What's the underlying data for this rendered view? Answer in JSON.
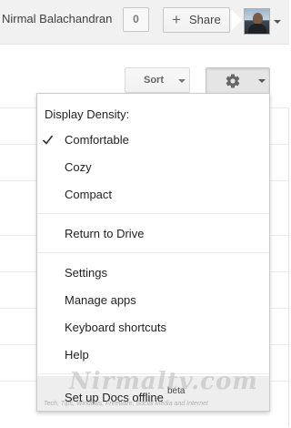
{
  "header": {
    "user_name": "Nirmal Balachandran",
    "notification_count": "0",
    "share_label": "Share",
    "avatar_icon": "user-avatar-photo"
  },
  "toolbar": {
    "sort_label": "Sort",
    "settings_icon": "gear-icon"
  },
  "menu": {
    "heading": "Display Density:",
    "density_options": [
      {
        "label": "Comfortable",
        "selected": true
      },
      {
        "label": "Cozy",
        "selected": false
      },
      {
        "label": "Compact",
        "selected": false
      }
    ],
    "return_label": "Return to Drive",
    "items": [
      {
        "label": "Settings"
      },
      {
        "label": "Manage apps"
      },
      {
        "label": "Keyboard shortcuts"
      },
      {
        "label": "Help"
      }
    ],
    "offline": {
      "label": "Set up Docs offline",
      "badge": "beta"
    }
  },
  "watermark": {
    "logo_text": "Nirmaltv.com",
    "tagline": "Tech, Tips, Windows, Freeware, Social Media and Internet"
  },
  "colors": {
    "header_bg": "#f1f1f1",
    "menu_hover_bg": "#eeeeee",
    "text": "#222222"
  }
}
